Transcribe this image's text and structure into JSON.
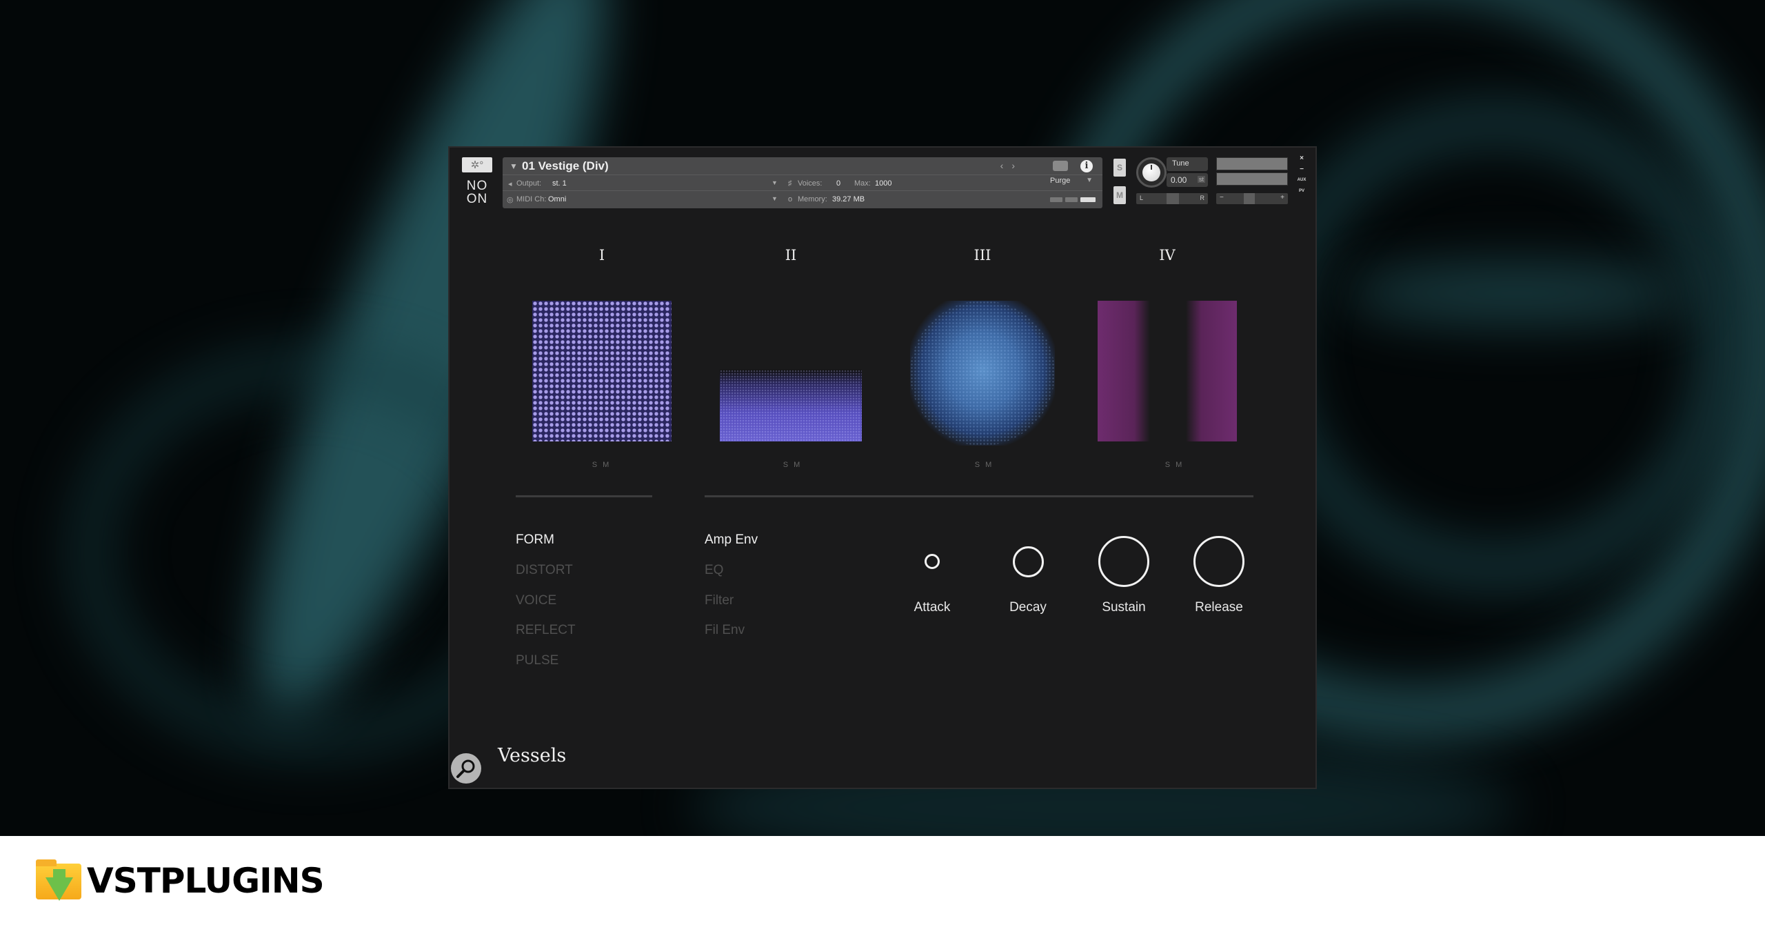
{
  "plugin": {
    "logo_icon": "gear-sun-icon",
    "vendor_mark": [
      "NO",
      "ON"
    ],
    "instrument_title": "01 Vestige (Div)",
    "output_label": "Output:",
    "output_value": "st. 1",
    "midi_label": "MIDI Ch:",
    "midi_value": "Omni",
    "voices_label": "Voices:",
    "voices_value": "0",
    "max_label": "Max:",
    "max_value": "1000",
    "memory_label": "Memory:",
    "memory_value": "39.27 MB",
    "purge_label": "Purge",
    "solo_label": "S",
    "mute_label": "M",
    "tune_label": "Tune",
    "tune_value": "0.00",
    "tune_unit": "st",
    "pan_left": "L",
    "pan_right": "R",
    "vol_minus": "−",
    "vol_plus": "+",
    "window_controls": [
      "×",
      "−",
      "AUX",
      "PV"
    ]
  },
  "layers": [
    {
      "label": "I",
      "solo": "S",
      "mute": "M",
      "color": "#a79ce8"
    },
    {
      "label": "II",
      "solo": "S",
      "mute": "M",
      "color": "#6a63c8"
    },
    {
      "label": "III",
      "solo": "S",
      "mute": "M",
      "color": "#5a8fc8"
    },
    {
      "label": "IV",
      "solo": "S",
      "mute": "M",
      "color": "#6e2c6e"
    }
  ],
  "left_menu": [
    {
      "label": "FORM",
      "active": true
    },
    {
      "label": "DISTORT",
      "active": false
    },
    {
      "label": "VOICE",
      "active": false
    },
    {
      "label": "REFLECT",
      "active": false
    },
    {
      "label": "PULSE",
      "active": false
    }
  ],
  "mid_menu": [
    {
      "label": "Amp Env",
      "active": true
    },
    {
      "label": "EQ",
      "active": false
    },
    {
      "label": "Filter",
      "active": false
    },
    {
      "label": "Fil Env",
      "active": false
    }
  ],
  "envelope": [
    {
      "label": "Attack",
      "value": 0.12
    },
    {
      "label": "Decay",
      "value": 0.5
    },
    {
      "label": "Sustain",
      "value": 1.0
    },
    {
      "label": "Release",
      "value": 1.0
    }
  ],
  "product_name": "Vessels",
  "footer": {
    "brand": "VSTPLUGINS"
  }
}
